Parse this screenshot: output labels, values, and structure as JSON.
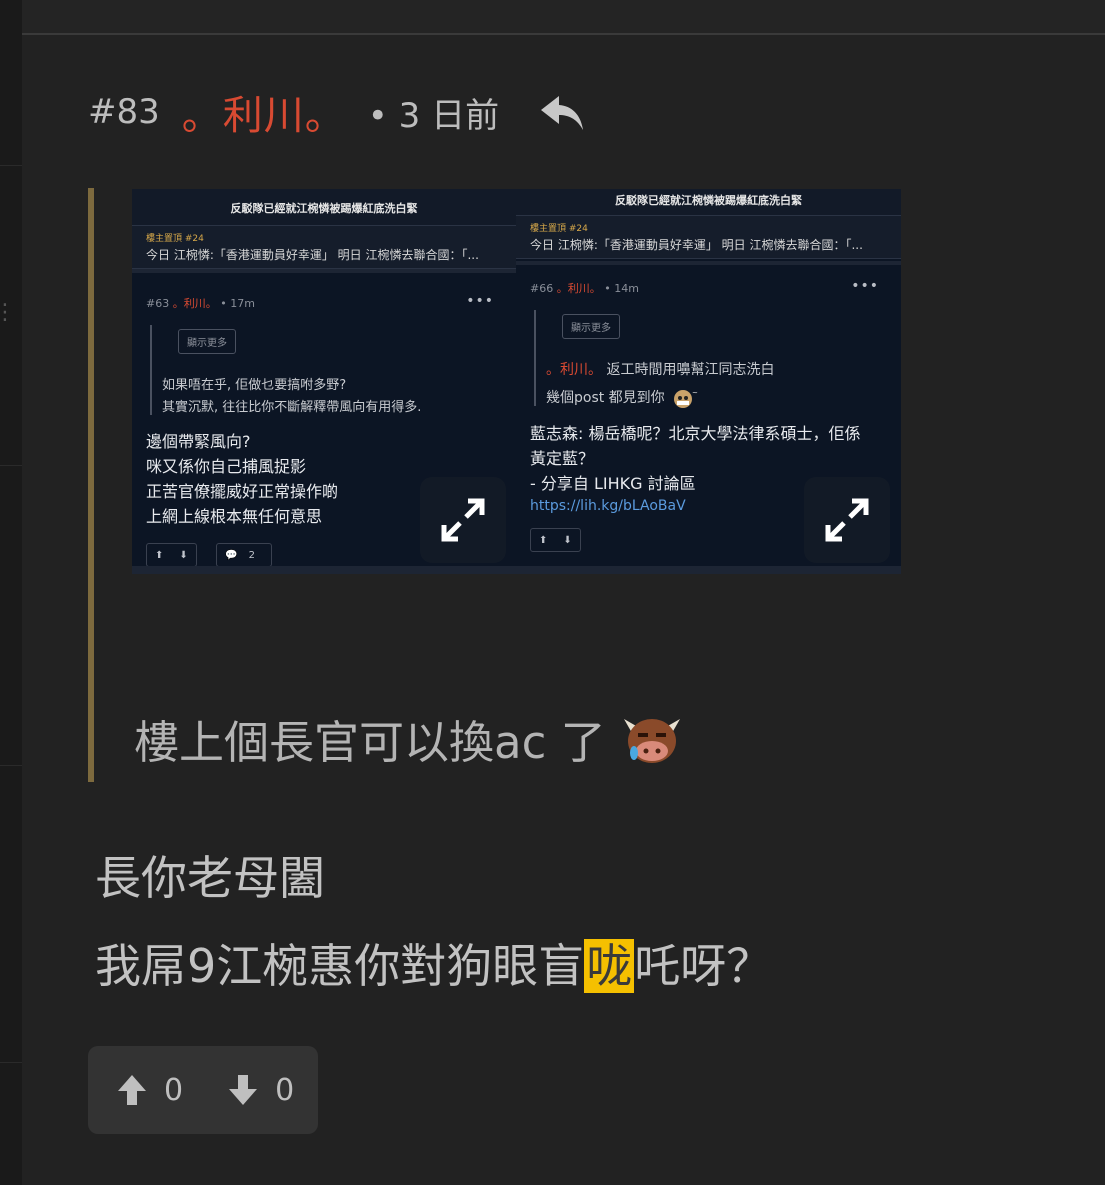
{
  "post": {
    "number": "#83",
    "author": "。利川。",
    "time": "• 3 日前"
  },
  "quoted_images": [
    {
      "title": "反駁隊已經就江椀憐被踢爆紅底洗白緊",
      "pinned_label": "樓主置頂 #24",
      "pinned_text": "今日 江椀憐:「香港運動員好幸運」 明日 江椀憐去聯合國：「...",
      "meta_num": "#63",
      "meta_author": "。利川。",
      "meta_time": "• 17m",
      "show_more": "顯示更多",
      "quote_lines": [
        "如果唔在乎, 佢做乜要搞咐多野?",
        "其實沉默, 往往比你不斷解釋帶風向有用得多."
      ],
      "body_lines": [
        "邊個帶緊風向?",
        "咪又係你自己捕風捉影",
        "正苦官僚擺威好正常操作啲",
        "上網上線根本無任何意思"
      ],
      "comment_count": "2"
    },
    {
      "title": "反駁隊已經就江椀憐被踢爆紅底洗白緊",
      "pinned_label": "樓主置頂 #24",
      "pinned_text": "今日 江椀憐:「香港運動員好幸運」 明日 江椀憐去聯合國：「...",
      "meta_num": "#66",
      "meta_author": "。利川。",
      "meta_time": "• 14m",
      "show_more": "顯示更多",
      "quote_author": "。利川。",
      "quote_line_1": "返工時間用嚊幫江同志洗白",
      "quote_line_2": "幾個post 都見到你",
      "body_lines": [
        "藍志森: 楊岳橋呢？北京大學法律系碩士，佢係",
        "黃定藍？",
        "- 分享自 LIHKG 討論區"
      ],
      "link": "https://lih.kg/bLAoBaV"
    }
  ],
  "quoted_text": "樓上個長官可以換ac 了",
  "reply": {
    "line1": "長你老母闔",
    "line2_before": "我屌9江椀惠你對狗眼盲",
    "line2_highlight": "咙",
    "line2_after": "吒呀？"
  },
  "votes": {
    "up": "0",
    "down": "0"
  },
  "colors": {
    "author": "#d84a32",
    "quote_bar": "#7d6a3e",
    "highlight": "#f5c000",
    "link": "#5b9bde"
  },
  "icons": [
    "reply-arrow-icon",
    "expand-icon",
    "thumb-up-arrow-icon",
    "thumb-down-arrow-icon",
    "bull-face-emoji",
    "monkey-emoji"
  ]
}
